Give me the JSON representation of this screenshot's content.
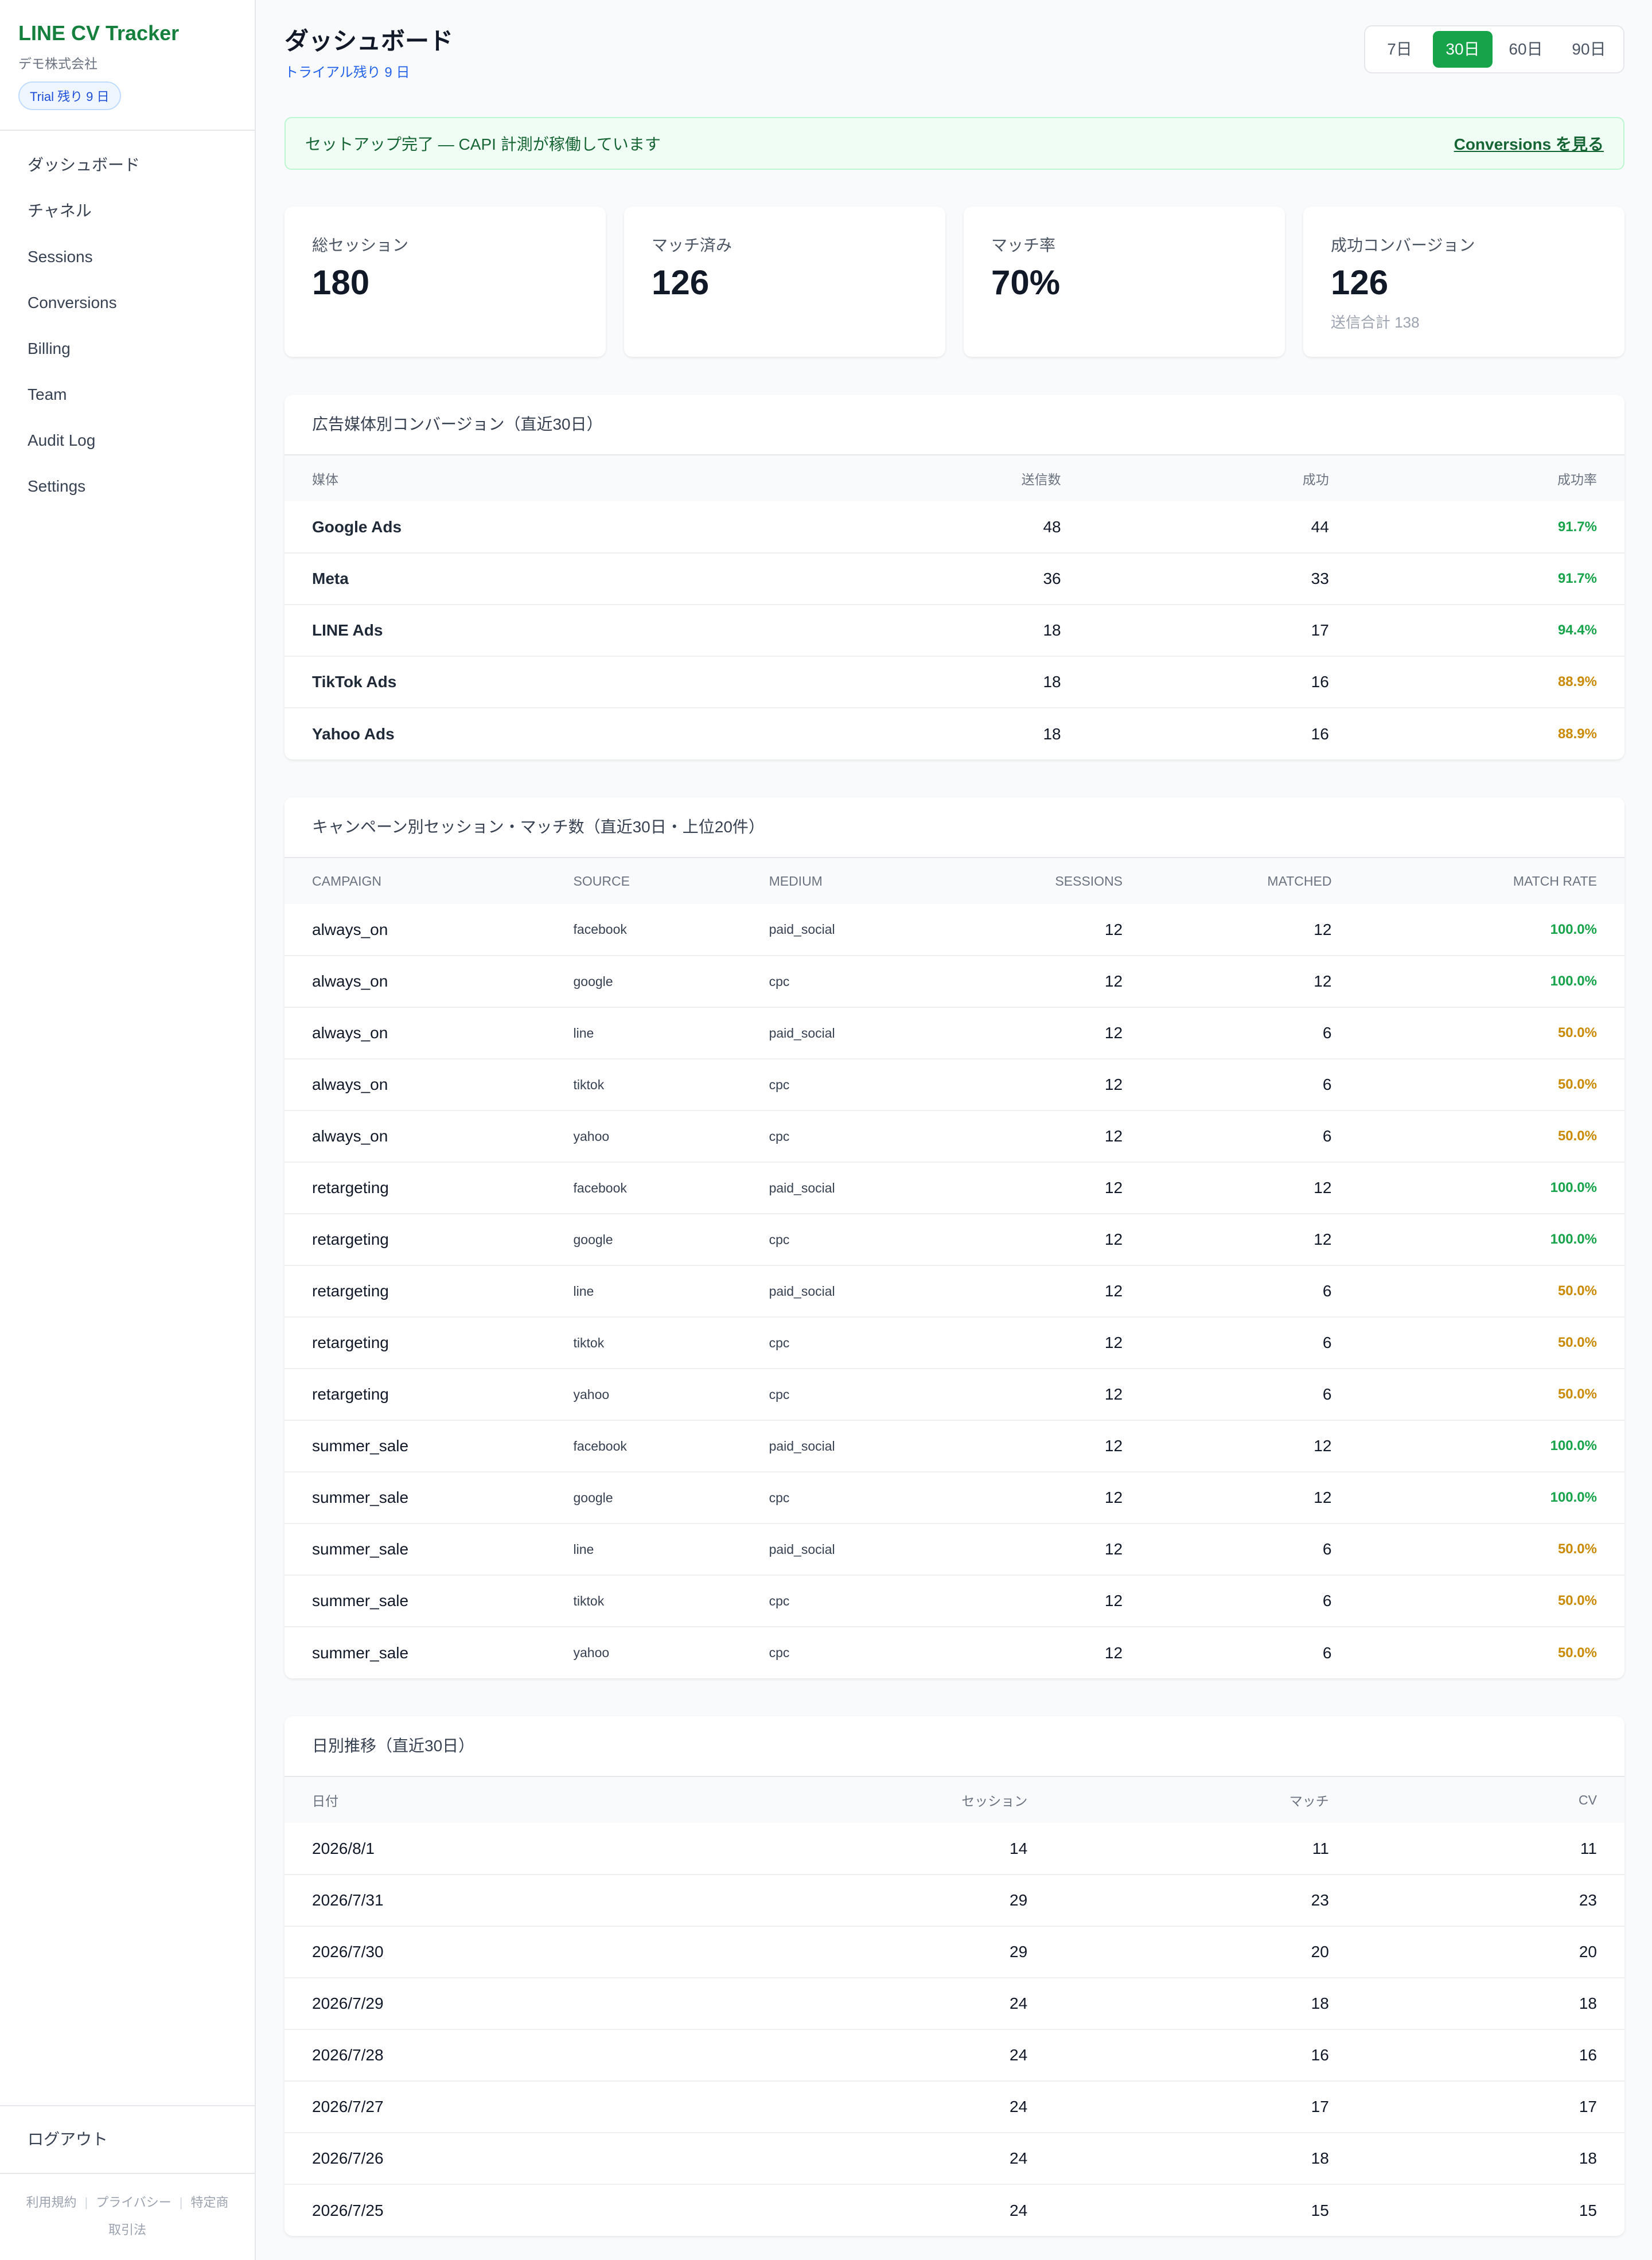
{
  "sidebar": {
    "brand": "LINE CV Tracker",
    "company": "デモ株式会社",
    "trial_badge": "Trial 残り 9 日",
    "nav": [
      "ダッシュボード",
      "チャネル",
      "Sessions",
      "Conversions",
      "Billing",
      "Team",
      "Audit Log",
      "Settings"
    ],
    "logout": "ログアウト",
    "legal": {
      "terms": "利用規約",
      "privacy": "プライバシー",
      "tokutei_1": "特定商",
      "tokutei_2": "取引法"
    }
  },
  "header": {
    "title": "ダッシュボード",
    "subtitle": "トライアル残り 9 日",
    "ranges": [
      "7日",
      "30日",
      "60日",
      "90日"
    ],
    "active_range": "30日"
  },
  "alert": {
    "message": "セットアップ完了 — CAPI 計測が稼働しています",
    "link": "Conversions を見る"
  },
  "kpis": [
    {
      "label": "総セッション",
      "value": "180"
    },
    {
      "label": "マッチ済み",
      "value": "126"
    },
    {
      "label": "マッチ率",
      "value": "70%"
    },
    {
      "label": "成功コンバージョン",
      "value": "126",
      "note": "送信合計 138"
    }
  ],
  "media_table": {
    "title": "広告媒体別コンバージョン（直近30日）",
    "headers": [
      "媒体",
      "送信数",
      "成功",
      "成功率"
    ],
    "rows": [
      {
        "media": "Google Ads",
        "sent": "48",
        "success": "44",
        "rate": "91.7%",
        "status": "good"
      },
      {
        "media": "Meta",
        "sent": "36",
        "success": "33",
        "rate": "91.7%",
        "status": "good"
      },
      {
        "media": "LINE Ads",
        "sent": "18",
        "success": "17",
        "rate": "94.4%",
        "status": "good"
      },
      {
        "media": "TikTok Ads",
        "sent": "18",
        "success": "16",
        "rate": "88.9%",
        "status": "warn"
      },
      {
        "media": "Yahoo Ads",
        "sent": "18",
        "success": "16",
        "rate": "88.9%",
        "status": "warn"
      }
    ]
  },
  "campaign_table": {
    "title": "キャンペーン別セッション・マッチ数（直近30日・上位20件）",
    "headers": [
      "CAMPAIGN",
      "SOURCE",
      "MEDIUM",
      "SESSIONS",
      "MATCHED",
      "MATCH RATE"
    ],
    "rows": [
      {
        "campaign": "always_on",
        "source": "facebook",
        "medium": "paid_social",
        "sessions": "12",
        "matched": "12",
        "rate": "100.0%",
        "status": "good"
      },
      {
        "campaign": "always_on",
        "source": "google",
        "medium": "cpc",
        "sessions": "12",
        "matched": "12",
        "rate": "100.0%",
        "status": "good"
      },
      {
        "campaign": "always_on",
        "source": "line",
        "medium": "paid_social",
        "sessions": "12",
        "matched": "6",
        "rate": "50.0%",
        "status": "warn"
      },
      {
        "campaign": "always_on",
        "source": "tiktok",
        "medium": "cpc",
        "sessions": "12",
        "matched": "6",
        "rate": "50.0%",
        "status": "warn"
      },
      {
        "campaign": "always_on",
        "source": "yahoo",
        "medium": "cpc",
        "sessions": "12",
        "matched": "6",
        "rate": "50.0%",
        "status": "warn"
      },
      {
        "campaign": "retargeting",
        "source": "facebook",
        "medium": "paid_social",
        "sessions": "12",
        "matched": "12",
        "rate": "100.0%",
        "status": "good"
      },
      {
        "campaign": "retargeting",
        "source": "google",
        "medium": "cpc",
        "sessions": "12",
        "matched": "12",
        "rate": "100.0%",
        "status": "good"
      },
      {
        "campaign": "retargeting",
        "source": "line",
        "medium": "paid_social",
        "sessions": "12",
        "matched": "6",
        "rate": "50.0%",
        "status": "warn"
      },
      {
        "campaign": "retargeting",
        "source": "tiktok",
        "medium": "cpc",
        "sessions": "12",
        "matched": "6",
        "rate": "50.0%",
        "status": "warn"
      },
      {
        "campaign": "retargeting",
        "source": "yahoo",
        "medium": "cpc",
        "sessions": "12",
        "matched": "6",
        "rate": "50.0%",
        "status": "warn"
      },
      {
        "campaign": "summer_sale",
        "source": "facebook",
        "medium": "paid_social",
        "sessions": "12",
        "matched": "12",
        "rate": "100.0%",
        "status": "good"
      },
      {
        "campaign": "summer_sale",
        "source": "google",
        "medium": "cpc",
        "sessions": "12",
        "matched": "12",
        "rate": "100.0%",
        "status": "good"
      },
      {
        "campaign": "summer_sale",
        "source": "line",
        "medium": "paid_social",
        "sessions": "12",
        "matched": "6",
        "rate": "50.0%",
        "status": "warn"
      },
      {
        "campaign": "summer_sale",
        "source": "tiktok",
        "medium": "cpc",
        "sessions": "12",
        "matched": "6",
        "rate": "50.0%",
        "status": "warn"
      },
      {
        "campaign": "summer_sale",
        "source": "yahoo",
        "medium": "cpc",
        "sessions": "12",
        "matched": "6",
        "rate": "50.0%",
        "status": "warn"
      }
    ]
  },
  "daily_table": {
    "title": "日別推移（直近30日）",
    "headers": [
      "日付",
      "セッション",
      "マッチ",
      "CV"
    ],
    "rows": [
      {
        "date": "2026/8/1",
        "sessions": "14",
        "match": "11",
        "cv": "11"
      },
      {
        "date": "2026/7/31",
        "sessions": "29",
        "match": "23",
        "cv": "23"
      },
      {
        "date": "2026/7/30",
        "sessions": "29",
        "match": "20",
        "cv": "20"
      },
      {
        "date": "2026/7/29",
        "sessions": "24",
        "match": "18",
        "cv": "18"
      },
      {
        "date": "2026/7/28",
        "sessions": "24",
        "match": "16",
        "cv": "16"
      },
      {
        "date": "2026/7/27",
        "sessions": "24",
        "match": "17",
        "cv": "17"
      },
      {
        "date": "2026/7/26",
        "sessions": "24",
        "match": "18",
        "cv": "18"
      },
      {
        "date": "2026/7/25",
        "sessions": "24",
        "match": "15",
        "cv": "15"
      }
    ]
  },
  "colors": {
    "brand_green": "#15803d",
    "accent_green": "#16a34a",
    "warn_amber": "#ca8a04",
    "link_blue": "#2563eb"
  }
}
